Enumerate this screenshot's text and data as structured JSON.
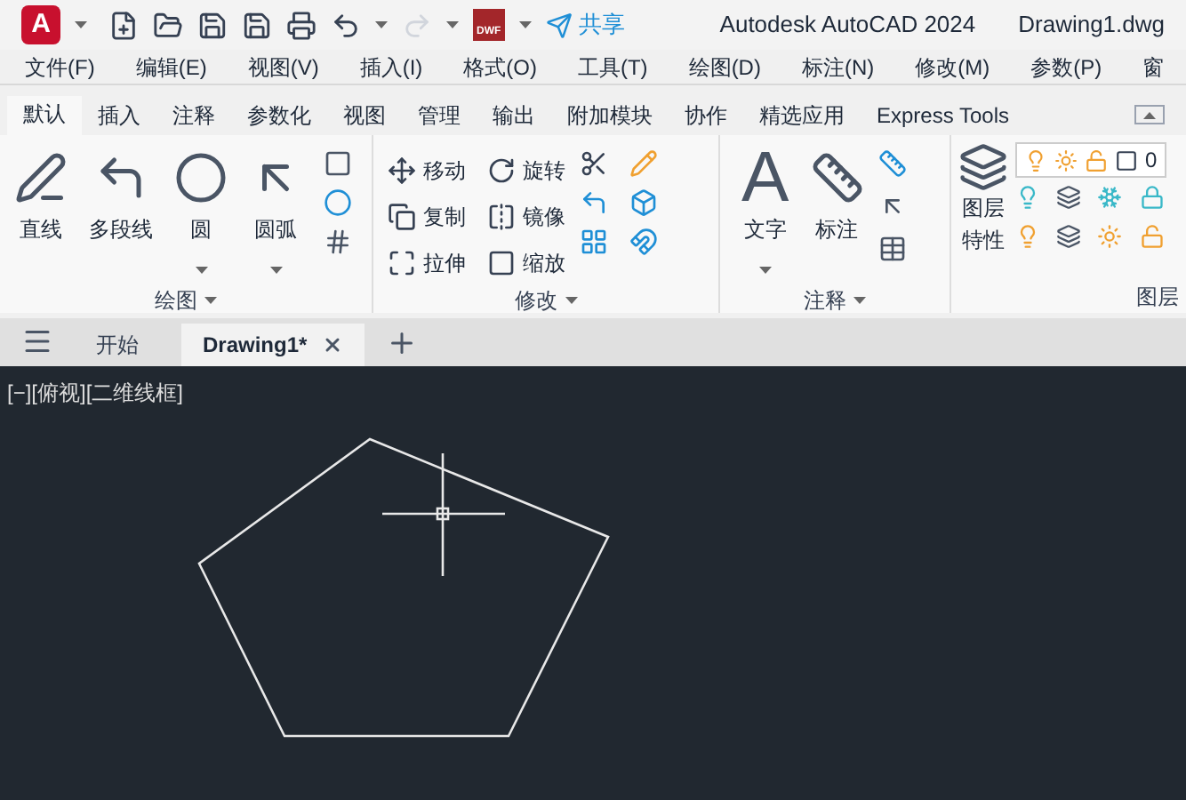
{
  "title_bar": {
    "app_button": "A",
    "dwf_label": "DWF",
    "share": "共享",
    "app_title": "Autodesk AutoCAD 2024",
    "file_name": "Drawing1.dwg"
  },
  "menu": [
    "文件(F)",
    "编辑(E)",
    "视图(V)",
    "插入(I)",
    "格式(O)",
    "工具(T)",
    "绘图(D)",
    "标注(N)",
    "修改(M)",
    "参数(P)",
    "窗"
  ],
  "ribbon_tabs": [
    {
      "label": "默认",
      "selected": true
    },
    {
      "label": "插入",
      "selected": false
    },
    {
      "label": "注释",
      "selected": false
    },
    {
      "label": "参数化",
      "selected": false
    },
    {
      "label": "视图",
      "selected": false
    },
    {
      "label": "管理",
      "selected": false
    },
    {
      "label": "输出",
      "selected": false
    },
    {
      "label": "附加模块",
      "selected": false
    },
    {
      "label": "协作",
      "selected": false
    },
    {
      "label": "精选应用",
      "selected": false
    },
    {
      "label": "Express Tools",
      "selected": false
    }
  ],
  "panels": {
    "draw": {
      "title": "绘图",
      "tools": [
        "直线",
        "多段线",
        "圆",
        "圆弧"
      ]
    },
    "modify": {
      "title": "修改",
      "tools": [
        "移动",
        "旋转",
        "复制",
        "镜像",
        "拉伸",
        "缩放"
      ]
    },
    "annotation": {
      "title": "注释",
      "tools": [
        "文字",
        "标注"
      ],
      "text_glyph": "A"
    },
    "layers": {
      "title": "图层",
      "properties": [
        "图层",
        "特性"
      ],
      "current_layer": "0"
    }
  },
  "file_tabs": [
    {
      "label": "开始",
      "selected": false
    },
    {
      "label": "Drawing1*",
      "selected": true
    }
  ],
  "viewport_label": "[−][俯视][二维线框]"
}
